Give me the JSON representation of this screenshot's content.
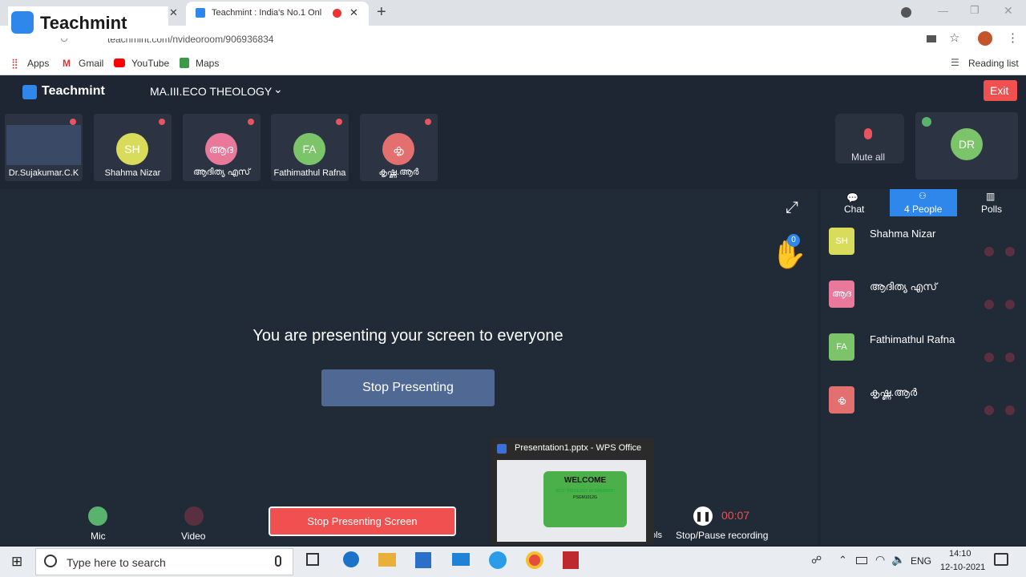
{
  "browser": {
    "logo_text": "Teachmint",
    "active_tab_title": "Teachmint : India's No.1 Onl",
    "url": "teachmint.com/nvideoroom/906936834",
    "bookmarks": [
      "Apps",
      "Gmail",
      "YouTube",
      "Maps"
    ],
    "reading_list": "Reading list"
  },
  "app": {
    "brand": "Teachmint",
    "classroom": "MA.III.ECO THEOLOGY",
    "exit_label": "Exit",
    "mute_all_label": "Mute all",
    "self_initials": "DR"
  },
  "tiles": [
    {
      "name": "Dr.Sujakumar.C.K",
      "initials": "",
      "color": "#2c3444"
    },
    {
      "name": "Shahma Nizar",
      "initials": "SH",
      "color": "#d8dc5a"
    },
    {
      "name": "ആദിത്യ എസ്",
      "initials": "ആദ",
      "color": "#e8799a"
    },
    {
      "name": "Fathimathul Rafna",
      "initials": "FA",
      "color": "#7cc46a"
    },
    {
      "name": "കൃഷ്ണ.ആർ",
      "initials": "കൃ",
      "color": "#e36f6f"
    }
  ],
  "stage": {
    "message": "You are presenting your screen to everyone",
    "stop_presenting": "Stop Presenting",
    "hand_count": "0"
  },
  "panel_tabs": {
    "chat": "Chat",
    "people": "4 People",
    "polls": "Polls"
  },
  "people": [
    {
      "name": "Shahma Nizar",
      "initials": "SH",
      "color": "#d8dc5a"
    },
    {
      "name": "ആദിത്യ എസ്",
      "initials": "ആദ",
      "color": "#e8799a"
    },
    {
      "name": "Fathimathul Rafna",
      "initials": "FA",
      "color": "#7cc46a"
    },
    {
      "name": "കൃഷ്ണ.ആർ",
      "initials": "കൃ",
      "color": "#e36f6f"
    }
  ],
  "controls": {
    "mic": "Mic",
    "video": "Video",
    "stop_screen": "Stop Presenting Screen",
    "timer": "00:07",
    "record_label": "Stop/Pause recording",
    "partial_label": "ols"
  },
  "preview": {
    "title": "Presentation1.pptx - WPS Office",
    "slide_title": "WELCOME",
    "slide_sub1": "ECO THEOLOGY IN SANSKRIT",
    "slide_sub2": "PSGM1012G"
  },
  "taskbar": {
    "search_placeholder": "Type here to search",
    "lang": "ENG",
    "time": "14:10",
    "date": "12-10-2021"
  },
  "colors": {
    "accent": "#2f86eb",
    "danger": "#f0504f",
    "background": "#1f2633"
  }
}
